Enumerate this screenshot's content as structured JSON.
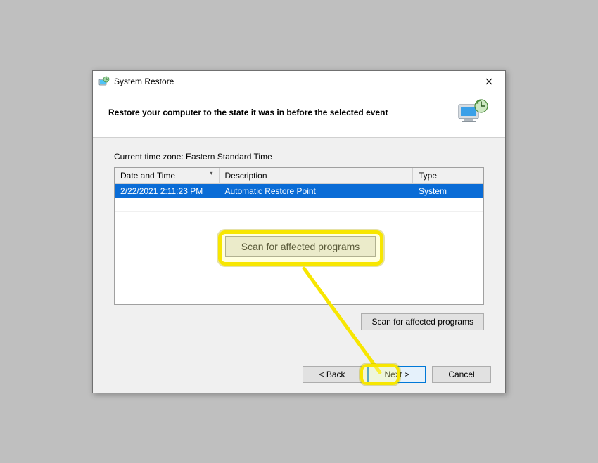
{
  "titlebar": {
    "title": "System Restore"
  },
  "header": {
    "heading": "Restore your computer to the state it was in before the selected event"
  },
  "content": {
    "timezone_label": "Current time zone: Eastern Standard Time",
    "columns": {
      "datetime": "Date and Time",
      "description": "Description",
      "type": "Type"
    },
    "rows": [
      {
        "datetime": "2/22/2021 2:11:23 PM",
        "description": "Automatic Restore Point",
        "type": "System"
      }
    ],
    "scan_button": "Scan for affected programs"
  },
  "callout": {
    "scan_button_large": "Scan for affected programs"
  },
  "footer": {
    "back": "< Back",
    "next": "Next >",
    "cancel": "Cancel"
  }
}
